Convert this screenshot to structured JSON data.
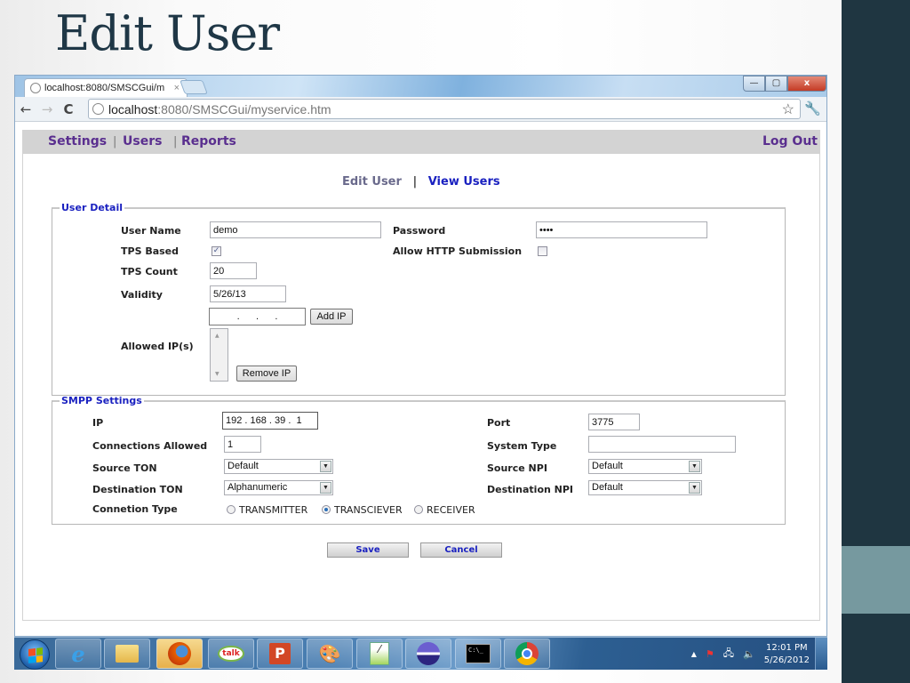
{
  "slide": {
    "title": "Edit User"
  },
  "browser": {
    "tab_title": "localhost:8080/SMSCGui/m",
    "tab_close": "×",
    "window_controls": {
      "minimize": "—",
      "maximize": "▢",
      "close": "x"
    },
    "nav": {
      "back": "←",
      "forward": "→",
      "reload": "C"
    },
    "url": {
      "host": "localhost",
      "rest": ":8080/SMSCGui/myservice.htm"
    },
    "bookmark_icon": "☆",
    "menu_icon": "🔧"
  },
  "page": {
    "menu": [
      {
        "label": "Settings"
      },
      {
        "label": "Users"
      },
      {
        "label": "Reports"
      }
    ],
    "menu_sep": "|",
    "logout": "Log Out",
    "subnav": {
      "current": "Edit User",
      "sep": "|",
      "link": "View Users"
    },
    "user_detail": {
      "legend": "User Detail",
      "user_name_label": "User Name",
      "user_name_value": "demo",
      "password_label": "Password",
      "password_value": "••••",
      "tps_based_label": "TPS Based",
      "tps_based_checked": true,
      "tps_based_mark": "✓",
      "allow_http_label": "Allow HTTP Submission",
      "allow_http_checked": false,
      "tps_count_label": "TPS Count",
      "tps_count_value": "20",
      "validity_label": "Validity",
      "validity_value": "5/26/13",
      "ip_entry_value": ".      .      .",
      "add_ip_button": "Add IP",
      "allowed_ips_label": "Allowed IP(s)",
      "allowed_ips": [],
      "remove_ip_button": "Remove IP"
    },
    "smpp_settings": {
      "legend": "SMPP Settings",
      "ip_label": "IP",
      "ip_value": "192 . 168 . 39 .  1",
      "port_label": "Port",
      "port_value": "3775",
      "connections_label": "Connections Allowed",
      "connections_value": "1",
      "system_type_label": "System Type",
      "system_type_value": "",
      "source_ton_label": "Source TON",
      "source_ton_value": "Default",
      "source_npi_label": "Source NPI",
      "source_npi_value": "Default",
      "dest_ton_label": "Destination TON",
      "dest_ton_value": "Alphanumeric",
      "dest_npi_label": "Destination NPI",
      "dest_npi_value": "Default",
      "connection_type_label": "Connetion Type",
      "connection_types": [
        {
          "label": "TRANSMITTER",
          "selected": false
        },
        {
          "label": "TRANSCIEVER",
          "selected": true
        },
        {
          "label": "RECEIVER",
          "selected": false
        }
      ],
      "dropdown_arrow": "▼"
    },
    "actions": {
      "save": "Save",
      "cancel": "Cancel"
    }
  },
  "taskbar": {
    "apps": [
      {
        "name": "internet-explorer",
        "glyph": "e"
      },
      {
        "name": "file-explorer",
        "glyph": "🗀"
      },
      {
        "name": "firefox",
        "glyph": "●",
        "active": true
      },
      {
        "name": "google-talk",
        "glyph": "talk"
      },
      {
        "name": "powerpoint",
        "glyph": "P"
      },
      {
        "name": "paint",
        "glyph": "🎨"
      },
      {
        "name": "notepad-plus-plus",
        "glyph": "⁄"
      },
      {
        "name": "eclipse",
        "glyph": "●"
      },
      {
        "name": "command-prompt",
        "glyph": "C:\\_"
      },
      {
        "name": "chrome",
        "glyph": "◉"
      }
    ],
    "tray": {
      "show_hidden": "▲",
      "flag": "⚑",
      "network": "🖧",
      "volume": "🔈"
    },
    "time": "12:01 PM",
    "date": "5/26/2012"
  }
}
